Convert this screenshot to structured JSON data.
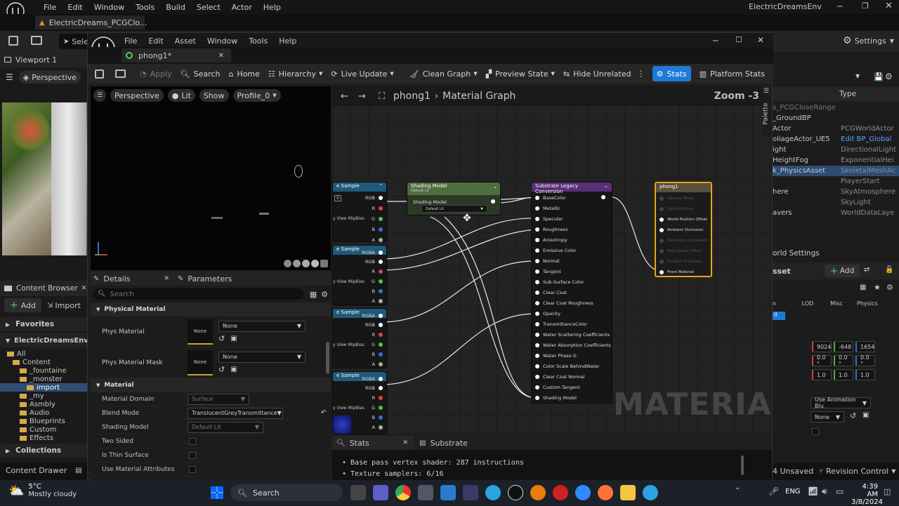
{
  "background_editor": {
    "menu": [
      "File",
      "Edit",
      "Window",
      "Tools",
      "Build",
      "Select",
      "Actor",
      "Help"
    ],
    "project_tab": "ElectricDreams_PCGClo...",
    "window_title": "ElectricDreamsEnv",
    "toolbar_partial": "Sele",
    "settings_label": "Settings",
    "viewport_tab": "Viewport 1",
    "perspective": "Perspective",
    "content_browser": {
      "tab": "Content Browser",
      "add": "Add",
      "import": "Import",
      "favorites": "Favorites",
      "project": "ElectricDreamsEnv",
      "tree": [
        "All",
        "Content",
        "_fountaine",
        "_monster",
        "import",
        "_my",
        "Asmbly",
        "Audio",
        "Blueprints",
        "Custom",
        "Effects"
      ],
      "collections": "Collections"
    },
    "content_drawer": "Content Drawer",
    "outliner": {
      "type_header": "Type",
      "rows": [
        {
          "name": "s_PCGCloseRange (Editor)",
          "type": ""
        },
        {
          "name": "_GroundBP",
          "type": ""
        },
        {
          "name": "Actor",
          "type": "PCGWorldActor"
        },
        {
          "name": "oliageActor_UE5",
          "type": "Edit BP_Global"
        },
        {
          "name": "ight",
          "type": "DirectionalLight"
        },
        {
          "name": "HeightFog",
          "type": "ExponentialHei"
        },
        {
          "name": "k_PhysicsAsset",
          "type": "SkeletalMeshAc"
        },
        {
          "name": "",
          "type": "PlayerStart"
        },
        {
          "name": "here",
          "type": "SkyAtmosphere"
        },
        {
          "name": "",
          "type": "SkyLight"
        },
        {
          "name": "avers",
          "type": "WorldDataLaye"
        }
      ],
      "world_settings": "orld Settings"
    },
    "details_right": {
      "asset_label": "sset",
      "add": "Add",
      "tabs": [
        "n",
        "LOD",
        "Misc",
        "Physics"
      ],
      "tab_selected": "ll",
      "location": [
        "9024",
        "-648",
        "1654"
      ],
      "rotation": [
        "0.0 °",
        "0.0 °",
        "0.0 °"
      ],
      "scale": [
        "1.0",
        "1.0",
        "1.0"
      ],
      "anim_mode": "Use Animation Blu",
      "none": "None"
    },
    "unsaved": "4 Unsaved",
    "revision": "Revision Control"
  },
  "material_editor": {
    "menu": [
      "File",
      "Edit",
      "Asset",
      "Window",
      "Tools",
      "Help"
    ],
    "tab": "phong1*",
    "toolbar": [
      "Apply",
      "Search",
      "Home",
      "Hierarchy",
      "Live Update",
      "Clean Graph",
      "Preview State",
      "Hide Unrelated",
      "Stats",
      "Platform Stats"
    ],
    "viewport": {
      "perspective": "Perspective",
      "lit": "Lit",
      "show": "Show",
      "profile": "Profile_0"
    },
    "details": {
      "tab": "Details",
      "params_tab": "Parameters",
      "search_placeholder": "Search",
      "sections": {
        "physical": "Physical Material",
        "material": "Material"
      },
      "phys_material": {
        "label": "Phys Material",
        "thumb": "None",
        "value": "None"
      },
      "phys_mask": {
        "label": "Phys Material Mask",
        "thumb": "None",
        "value": "None"
      },
      "props": [
        {
          "label": "Material Domain",
          "value": "Surface",
          "disabled": true
        },
        {
          "label": "Blend Mode",
          "value": "TranslucentGreyTransmittance",
          "disabled": false
        },
        {
          "label": "Shading Model",
          "value": "Default Lit",
          "disabled": true
        },
        {
          "label": "Two Sided",
          "value": "",
          "disabled": false
        },
        {
          "label": "Is Thin Surface",
          "value": "",
          "disabled": false
        },
        {
          "label": "Use Material Attributes",
          "value": "",
          "disabled": false
        }
      ]
    },
    "graph": {
      "breadcrumb_asset": "phong1",
      "breadcrumb_graph": "Material Graph",
      "zoom": "Zoom -3",
      "palette": "Palette",
      "watermark": "MATERIAL",
      "texture_nodes": [
        {
          "title": "e Sample",
          "pins": [
            "RGB",
            "R",
            "G",
            "B",
            "A"
          ],
          "side_label": "y View MipBias"
        },
        {
          "title": "e Sample",
          "pins": [
            "RGBA",
            "RGB",
            "R",
            "G",
            "B",
            "A"
          ],
          "side_label": "y View MipBias"
        },
        {
          "title": "e Sample",
          "pins": [
            "RGBA",
            "RGB",
            "R",
            "G",
            "B",
            "A"
          ],
          "side_label": "y View MipBias"
        },
        {
          "title": "e Sample",
          "pins": [
            "RGBA",
            "RGB",
            "R",
            "G",
            "B",
            "A"
          ],
          "side_label": "y View MipBias"
        }
      ],
      "shading_node": {
        "title": "Shading Model",
        "subtitle": "Default Lit",
        "pin": "Shading Model",
        "value": "Default Lit"
      },
      "substrate_node": {
        "title": "Substrate Legacy Conversion",
        "pins": [
          "BaseColor",
          "Metallic",
          "Specular",
          "Roughness",
          "Anisotropy",
          "Emissive Color",
          "Normal",
          "Tangent",
          "Sub-Surface Color",
          "Clear Coat",
          "Clear Coat Roughness",
          "Opacity",
          "TransmittanceColor",
          "Water Scattering Coefficients",
          "Water Absorption Coefficients",
          "Water Phase G",
          "Color Scale BehindWater",
          "Clear Coat Normal",
          "Custom Tangent",
          "Shading Model"
        ]
      },
      "output_node": {
        "title": "phong1",
        "pins": [
          "Opacity Mask",
          "Opacity Mask",
          "World Position Offset",
          "Ambient Occlusion",
          "Refraction (Disabled)",
          "Pixel Depth Offset",
          "Surface Thickness",
          "Front Material"
        ],
        "active": [
          false,
          false,
          true,
          true,
          false,
          false,
          false,
          true
        ]
      }
    },
    "stats": {
      "tab": "Stats",
      "substrate_tab": "Substrate",
      "lines": [
        "Base pass vertex shader: 287 instructions",
        "Texture samplers: 6/16"
      ]
    }
  },
  "taskbar": {
    "weather_temp": "5°C",
    "weather_desc": "Mostly cloudy",
    "search": "Search",
    "lang": "ENG",
    "time": "4:39 AM",
    "date": "3/8/2024"
  },
  "colors": {
    "accent": "#1e7ad6",
    "texture_header": "#1f5a7a",
    "shading_header": "#4e6e3e",
    "substrate_header": "#5a2f7a",
    "output_border": "#e8a317"
  }
}
